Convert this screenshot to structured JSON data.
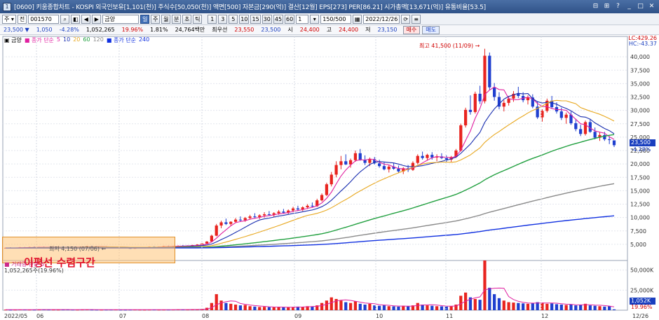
{
  "window": {
    "icon": "chart-window-icon",
    "title": "[0600] 키움종합차트 - KOSPI 외국인보유[1,101(천)] 주식수[50,050(천)] 액면[500] 자본금[290(억)] 결산[12월] EPS[273] PER[86.21] 시가총액[13,671(억)] 유통비율[53.5]",
    "controls": [
      "⊟",
      "⊞",
      "?",
      "_",
      "□",
      "✕"
    ]
  },
  "toolbar": {
    "mode": "주 ▾",
    "market": "전",
    "code": "001570",
    "stock_name": "금양",
    "buttons": [
      "⌕",
      "◧",
      "◀",
      "▶"
    ],
    "period_buttons": [
      "일",
      "주",
      "월",
      "분",
      "초",
      "틱"
    ],
    "active_period": "일",
    "interval_buttons": [
      "1",
      "3",
      "5",
      "10",
      "15",
      "30",
      "45",
      "60"
    ],
    "count_value": "1",
    "range_value": "150/500",
    "date_value": "2022/12/26"
  },
  "quote": {
    "price": "23,500 ▼",
    "change": "1,050",
    "change_pct": "-4.28%",
    "volume": "1,052,265",
    "ratio1": "19.96%",
    "ratio2": "1.81%",
    "amount": "24,764백만",
    "preferred_label": "최우선",
    "ask": "23,550",
    "bid": "23,500",
    "open_label": "시",
    "open": "24,400",
    "high_label": "고",
    "high": "24,400",
    "low_label": "저",
    "low": "23,150",
    "buy_label": "매수",
    "sell_label": "매도"
  },
  "legend": {
    "main": "▣ 금양",
    "ma": "■ 종가 단순",
    "p5": "5",
    "p10": "10",
    "p20": "20",
    "p60": "60",
    "p120": "120",
    "ma2": "■ 종가 단순",
    "p240": "240"
  },
  "overlays": {
    "annotation": "이평선 수렴구간",
    "small_label": "최저 4,150 (07/06) ←",
    "high_label": "최고 41,500 (11/09) →",
    "lc": "LC:429.26",
    "hc": "HC:-43.37",
    "price_tag": "23,500",
    "price_pct": "-4.28%",
    "vol_legend": "■ 거래량 단순 5",
    "vol_value": "1,052,265주(19.96%)",
    "vol_tag": "1,052K",
    "vol_pct": "19.96%"
  },
  "colors": {
    "up": "#e8241f",
    "down": "#1f3fcf",
    "ma5": "#e020a0",
    "ma10": "#1a2fb0",
    "ma20": "#e8a820",
    "ma60": "#22a040",
    "ma120": "#8a8a8a",
    "ma240": "#1030e0"
  },
  "chart_data": {
    "type": "candlestick",
    "price_axis": [
      "40,000",
      "37,500",
      "35,000",
      "32,500",
      "30,000",
      "27,500",
      "25,000",
      "22,500",
      "20,000",
      "17,500",
      "15,000",
      "12,500",
      "10,000",
      "7,500",
      "5,000"
    ],
    "price_ticks": [
      40000,
      37500,
      35000,
      32500,
      30000,
      27500,
      25000,
      22500,
      20000,
      17500,
      15000,
      12500,
      10000,
      7500,
      5000
    ],
    "volume_axis": [
      "50,000K",
      "25,000K"
    ],
    "volume_ticks": [
      50000,
      25000
    ],
    "date_axis": [
      "2022/05",
      "06",
      "07",
      "08",
      "09",
      "10",
      "11",
      "12",
      "12/26"
    ],
    "price_range": [
      2500,
      42500
    ],
    "volume_max": 62000,
    "grid": true,
    "candles_note": "daily OHLC approximations read from chart",
    "candles": [
      [
        4300,
        4400,
        4200,
        4350
      ],
      [
        4350,
        4450,
        4250,
        4300
      ],
      [
        4300,
        4400,
        4200,
        4380
      ],
      [
        4380,
        4500,
        4300,
        4420
      ],
      [
        4420,
        4500,
        4350,
        4400
      ],
      [
        4400,
        4550,
        4350,
        4480
      ],
      [
        4480,
        4600,
        4400,
        4450
      ],
      [
        4450,
        4550,
        4380,
        4500
      ],
      [
        4500,
        4600,
        4400,
        4420
      ],
      [
        4420,
        4500,
        4300,
        4380
      ],
      [
        4380,
        4480,
        4300,
        4450
      ],
      [
        4450,
        4600,
        4400,
        4550
      ],
      [
        4550,
        4650,
        4450,
        4500
      ],
      [
        4500,
        4600,
        4400,
        4480
      ],
      [
        4480,
        4550,
        4380,
        4420
      ],
      [
        4420,
        4500,
        4350,
        4480
      ],
      [
        4480,
        4600,
        4400,
        4560
      ],
      [
        4560,
        4700,
        4500,
        4620
      ],
      [
        4620,
        4750,
        4550,
        4580
      ],
      [
        4580,
        4650,
        4450,
        4500
      ],
      [
        4500,
        4600,
        4400,
        4550
      ],
      [
        4550,
        4650,
        4450,
        4500
      ],
      [
        4500,
        4580,
        4350,
        4400
      ],
      [
        4400,
        4500,
        4300,
        4450
      ],
      [
        4450,
        4550,
        4350,
        4400
      ],
      [
        4400,
        4480,
        4250,
        4300
      ],
      [
        4300,
        4400,
        4150,
        4250
      ],
      [
        4250,
        4350,
        4150,
        4320
      ],
      [
        4320,
        4450,
        4250,
        4400
      ],
      [
        4400,
        4500,
        4300,
        4450
      ],
      [
        4450,
        4600,
        4400,
        4550
      ],
      [
        4550,
        4650,
        4450,
        4500
      ],
      [
        4500,
        4600,
        4400,
        4560
      ],
      [
        4560,
        4700,
        4500,
        4650
      ],
      [
        4650,
        4750,
        4550,
        4600
      ],
      [
        4600,
        4700,
        4500,
        4680
      ],
      [
        4680,
        4800,
        4600,
        4720
      ],
      [
        4720,
        4850,
        4650,
        4700
      ],
      [
        4700,
        4800,
        4600,
        4750
      ],
      [
        4750,
        4900,
        4700,
        4850
      ],
      [
        4850,
        5000,
        4800,
        4950
      ],
      [
        4950,
        5200,
        4900,
        5150
      ],
      [
        5150,
        5600,
        5100,
        5500
      ],
      [
        5500,
        6800,
        5400,
        6600
      ],
      [
        6600,
        8800,
        6500,
        8500
      ],
      [
        8500,
        9400,
        8000,
        9100
      ],
      [
        9100,
        9800,
        8600,
        8800
      ],
      [
        8800,
        9300,
        8400,
        9200
      ],
      [
        9200,
        9900,
        9000,
        9600
      ],
      [
        9600,
        10200,
        9200,
        9500
      ],
      [
        9500,
        10100,
        9200,
        9900
      ],
      [
        9900,
        10500,
        9600,
        10200
      ],
      [
        10200,
        10800,
        9800,
        10100
      ],
      [
        10100,
        10600,
        9700,
        10400
      ],
      [
        10400,
        11000,
        10000,
        10600
      ],
      [
        10600,
        11200,
        10300,
        10500
      ],
      [
        10500,
        11000,
        10100,
        10800
      ],
      [
        10800,
        11400,
        10500,
        11100
      ],
      [
        11100,
        11600,
        10700,
        10900
      ],
      [
        10900,
        11500,
        10600,
        11300
      ],
      [
        11300,
        12000,
        11000,
        11700
      ],
      [
        11700,
        12200,
        11200,
        11500
      ],
      [
        11500,
        12100,
        11200,
        11900
      ],
      [
        11900,
        12500,
        11600,
        12200
      ],
      [
        12200,
        12800,
        11900,
        12100
      ],
      [
        12100,
        13500,
        12000,
        13200
      ],
      [
        13200,
        14500,
        13000,
        14200
      ],
      [
        14200,
        16500,
        14000,
        16200
      ],
      [
        16200,
        18500,
        15800,
        18000
      ],
      [
        18000,
        20500,
        17500,
        19800
      ],
      [
        19800,
        21500,
        19000,
        20500
      ],
      [
        20500,
        21800,
        19800,
        19900
      ],
      [
        19900,
        21000,
        19300,
        20700
      ],
      [
        20700,
        22500,
        20400,
        22000
      ],
      [
        22000,
        22800,
        20600,
        20800
      ],
      [
        20800,
        21600,
        19800,
        20200
      ],
      [
        20200,
        21200,
        19600,
        20900
      ],
      [
        20900,
        21300,
        19900,
        20100
      ],
      [
        20100,
        20800,
        19300,
        19600
      ],
      [
        19600,
        20300,
        18800,
        19000
      ],
      [
        19000,
        19800,
        18400,
        19500
      ],
      [
        19500,
        20200,
        18900,
        19100
      ],
      [
        19100,
        19700,
        18300,
        18600
      ],
      [
        18600,
        19400,
        18100,
        19200
      ],
      [
        19200,
        19800,
        18500,
        18900
      ],
      [
        18900,
        20500,
        18700,
        20200
      ],
      [
        20200,
        21800,
        19900,
        21500
      ],
      [
        21500,
        22300,
        20800,
        21100
      ],
      [
        21100,
        21900,
        20600,
        21700
      ],
      [
        21700,
        22200,
        20800,
        21200
      ],
      [
        21200,
        21800,
        20500,
        21400
      ],
      [
        21400,
        22000,
        20900,
        21100
      ],
      [
        21100,
        21600,
        20300,
        20800
      ],
      [
        20800,
        21500,
        20400,
        21300
      ],
      [
        21300,
        22800,
        21100,
        22500
      ],
      [
        22500,
        27500,
        22300,
        27200
      ],
      [
        27200,
        30500,
        26800,
        30100
      ],
      [
        30100,
        32800,
        29200,
        29700
      ],
      [
        29700,
        33500,
        29400,
        33100
      ],
      [
        33100,
        34600,
        31200,
        31700
      ],
      [
        31700,
        41500,
        31300,
        40200
      ],
      [
        40200,
        40800,
        33800,
        34300
      ],
      [
        34300,
        35100,
        31800,
        32500
      ],
      [
        32500,
        33400,
        30200,
        30700
      ],
      [
        30700,
        31900,
        29800,
        31400
      ],
      [
        31400,
        32700,
        30900,
        32200
      ],
      [
        32200,
        33600,
        31600,
        33100
      ],
      [
        33100,
        34400,
        32300,
        32700
      ],
      [
        32700,
        33400,
        31500,
        31900
      ],
      [
        31900,
        32800,
        31100,
        32400
      ],
      [
        32400,
        33000,
        30400,
        30700
      ],
      [
        30700,
        31600,
        28400,
        28700
      ],
      [
        28700,
        30200,
        27900,
        29900
      ],
      [
        29900,
        32200,
        29600,
        31800
      ],
      [
        31800,
        32700,
        30300,
        30600
      ],
      [
        30600,
        31500,
        29400,
        29800
      ],
      [
        29800,
        30500,
        28200,
        28600
      ],
      [
        28600,
        29600,
        27500,
        29200
      ],
      [
        29200,
        29800,
        27300,
        27600
      ],
      [
        27600,
        28400,
        26100,
        26500
      ],
      [
        26500,
        27300,
        25200,
        25600
      ],
      [
        25600,
        28100,
        25300,
        27800
      ],
      [
        27800,
        28400,
        25800,
        26000
      ],
      [
        26000,
        26800,
        24600,
        24900
      ],
      [
        24900,
        25900,
        24300,
        25400
      ],
      [
        25400,
        26000,
        24300,
        24600
      ],
      [
        24600,
        25200,
        23700,
        24500
      ],
      [
        24400,
        24400,
        23150,
        23500
      ]
    ],
    "volumes_note": "daily volume in thousands, approximated",
    "volumes": [
      700,
      600,
      650,
      900,
      800,
      700,
      650,
      800,
      900,
      750,
      700,
      650,
      800,
      850,
      700,
      650,
      800,
      900,
      700,
      650,
      600,
      700,
      750,
      800,
      650,
      600,
      700,
      750,
      650,
      600,
      700,
      800,
      650,
      700,
      750,
      800,
      900,
      850,
      800,
      900,
      1000,
      1500,
      3000,
      9000,
      20000,
      12000,
      9000,
      8000,
      7000,
      6000,
      6500,
      5000,
      4500,
      4000,
      4200,
      3800,
      3600,
      4000,
      3800,
      3500,
      4000,
      4500,
      4200,
      5000,
      4800,
      6000,
      9000,
      12000,
      16000,
      14000,
      12000,
      10000,
      9000,
      11000,
      8000,
      7000,
      8000,
      6000,
      5500,
      6000,
      5000,
      4800,
      4500,
      5500,
      5000,
      6000,
      9000,
      7000,
      6000,
      5500,
      5000,
      4800,
      4500,
      5000,
      7000,
      18000,
      22000,
      16000,
      14000,
      13000,
      62000,
      28000,
      20000,
      15000,
      12000,
      10000,
      9500,
      9000,
      8500,
      8000,
      9000,
      10000,
      9500,
      8000,
      8500,
      7500,
      7000,
      6500,
      7000,
      6000,
      6500,
      8000,
      6000,
      5500,
      5000,
      4500,
      4800,
      1052
    ],
    "moving_averages": [
      {
        "name": "5",
        "period": 5,
        "color": "#e020a0"
      },
      {
        "name": "10",
        "period": 10,
        "color": "#1a2fb0"
      },
      {
        "name": "20",
        "period": 20,
        "color": "#e8a820"
      },
      {
        "name": "60",
        "period": 60,
        "color": "#22a040"
      },
      {
        "name": "120",
        "period": 120,
        "color": "#8a8a8a"
      },
      {
        "name": "240",
        "period": 240,
        "color": "#1030e0"
      }
    ]
  }
}
